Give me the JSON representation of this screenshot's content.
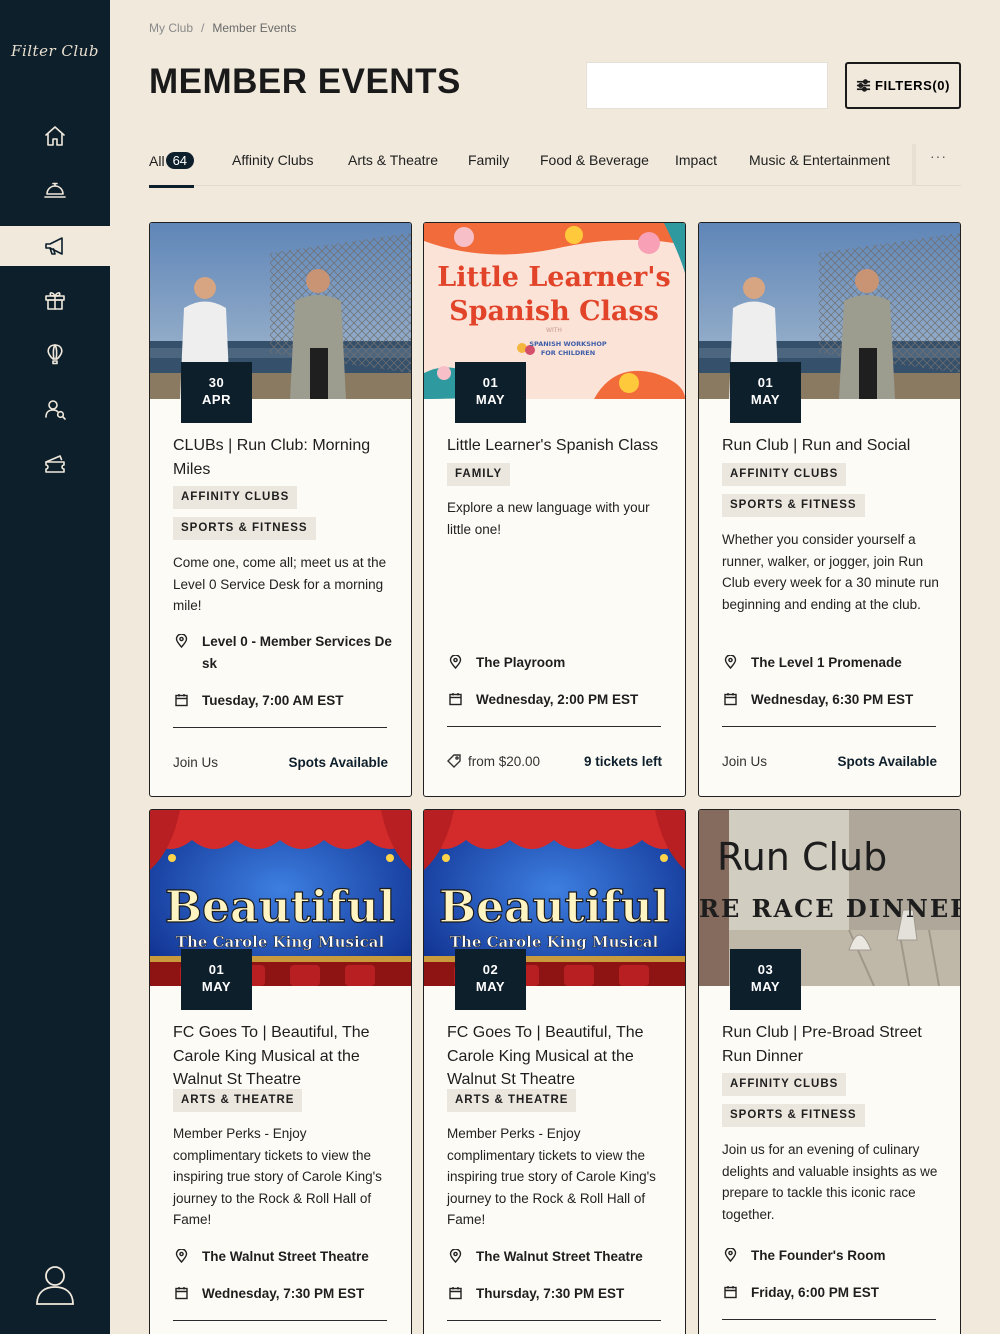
{
  "sidebar": {
    "logo": "Filter Club",
    "items": [
      {
        "name": "home-icon"
      },
      {
        "name": "concierge-icon"
      },
      {
        "name": "megaphone-icon"
      },
      {
        "name": "gift-icon"
      },
      {
        "name": "balloon-icon"
      },
      {
        "name": "members-icon"
      },
      {
        "name": "ticket-icon"
      }
    ],
    "active_item": "megaphone-icon",
    "profile_icon": "user-icon"
  },
  "breadcrumb": [
    "My Club",
    "/",
    "Member Events"
  ],
  "page_title": "MEMBER EVENTS",
  "search": {
    "placeholder": "",
    "value": ""
  },
  "filters_label": "FILTERS(0)",
  "tabs": [
    {
      "label": "All",
      "count": "64"
    },
    {
      "label": "Affinity Clubs"
    },
    {
      "label": "Arts & Theatre"
    },
    {
      "label": "Family"
    },
    {
      "label": "Food & Beverage"
    },
    {
      "label": "Impact"
    },
    {
      "label": "Music & Entertainment"
    }
  ],
  "more_label": "···",
  "colors": {
    "background": "#f0e9dc",
    "sidebar": "#0e1f2c",
    "accent": "#0e1f2c",
    "card": "#fdfbf6",
    "tag": "#ece7de"
  },
  "cards": [
    {
      "day": "30",
      "month": "APR",
      "title": "CLUBs | Run Club: Morning Miles",
      "tags": [
        "AFFINITY CLUBS",
        "SPORTS & FITNESS"
      ],
      "description": "Come one, come all; meet us at the Level 0 Service Desk for a morning mile!",
      "location": "Level 0 - Member Services De sk",
      "datetime": "Tuesday, 7:00 AM EST",
      "footer_left": "Join Us",
      "footer_right": "Spots Available",
      "image": "runners-photo"
    },
    {
      "day": "01",
      "month": "MAY",
      "title": "Little Learner's Spanish Class",
      "tags": [
        "FAMILY"
      ],
      "description": "Explore a new language with your little one!",
      "location": "The Playroom",
      "datetime": "Wednesday, 2:00 PM EST",
      "footer_left": "from $20.00",
      "footer_right": "9 tickets left",
      "image": "spanish-class-poster",
      "image_text": {
        "line1": "Little Learner's",
        "line2": "Spanish Class",
        "small1": "WITH",
        "small2": "SPANISH WORKSHOP",
        "small3": "FOR CHILDREN"
      }
    },
    {
      "day": "01",
      "month": "MAY",
      "title": "Run Club | Run and Social",
      "tags": [
        "AFFINITY CLUBS",
        "SPORTS & FITNESS"
      ],
      "description": "Whether you consider yourself a runner, walker, or jogger, join Run Club every week for a 30 minute run beginning and ending at the club.",
      "location": "The Level 1 Promenade",
      "datetime": "Wednesday, 6:30 PM EST",
      "footer_left": "Join Us",
      "footer_right": "Spots Available",
      "image": "runners-photo"
    },
    {
      "day": "01",
      "month": "MAY",
      "title": "FC Goes To | Beautiful, The Carole King Musical at the Walnut St Theatre",
      "tags": [
        "ARTS & THEATRE"
      ],
      "description": "Member Perks - Enjoy complimentary tickets to view the inspiring true story of Carole King's journey to the Rock & Roll Hall of Fame!",
      "location": "The Walnut Street Theatre",
      "datetime": "Wednesday, 7:30 PM EST",
      "image": "beautiful-musical-poster",
      "image_text": {
        "line1": "Beautiful",
        "line2": "The Carole King Musical"
      }
    },
    {
      "day": "02",
      "month": "MAY",
      "title": "FC Goes To | Beautiful, The Carole King Musical at the Walnut St Theatre",
      "tags": [
        "ARTS & THEATRE"
      ],
      "description": "Member Perks - Enjoy complimentary tickets to view the inspiring true story of Carole King's journey to the Rock & Roll Hall of Fame!",
      "location": "The Walnut Street Theatre",
      "datetime": "Thursday, 7:30 PM EST",
      "image": "beautiful-musical-poster",
      "image_text": {
        "line1": "Beautiful",
        "line2": "The Carole King Musical"
      }
    },
    {
      "day": "03",
      "month": "MAY",
      "title": "Run Club | Pre-Broad Street Run Dinner",
      "tags": [
        "AFFINITY CLUBS",
        "SPORTS & FITNESS"
      ],
      "description": "Join us for an evening of culinary delights and valuable insights as we prepare to tackle this iconic race together.",
      "location": "The Founder's Room",
      "datetime": "Friday, 6:00 PM EST",
      "image": "race-dinner-poster",
      "image_text": {
        "line1": "Run Club",
        "line2": "RE RACE DINNER"
      }
    }
  ]
}
